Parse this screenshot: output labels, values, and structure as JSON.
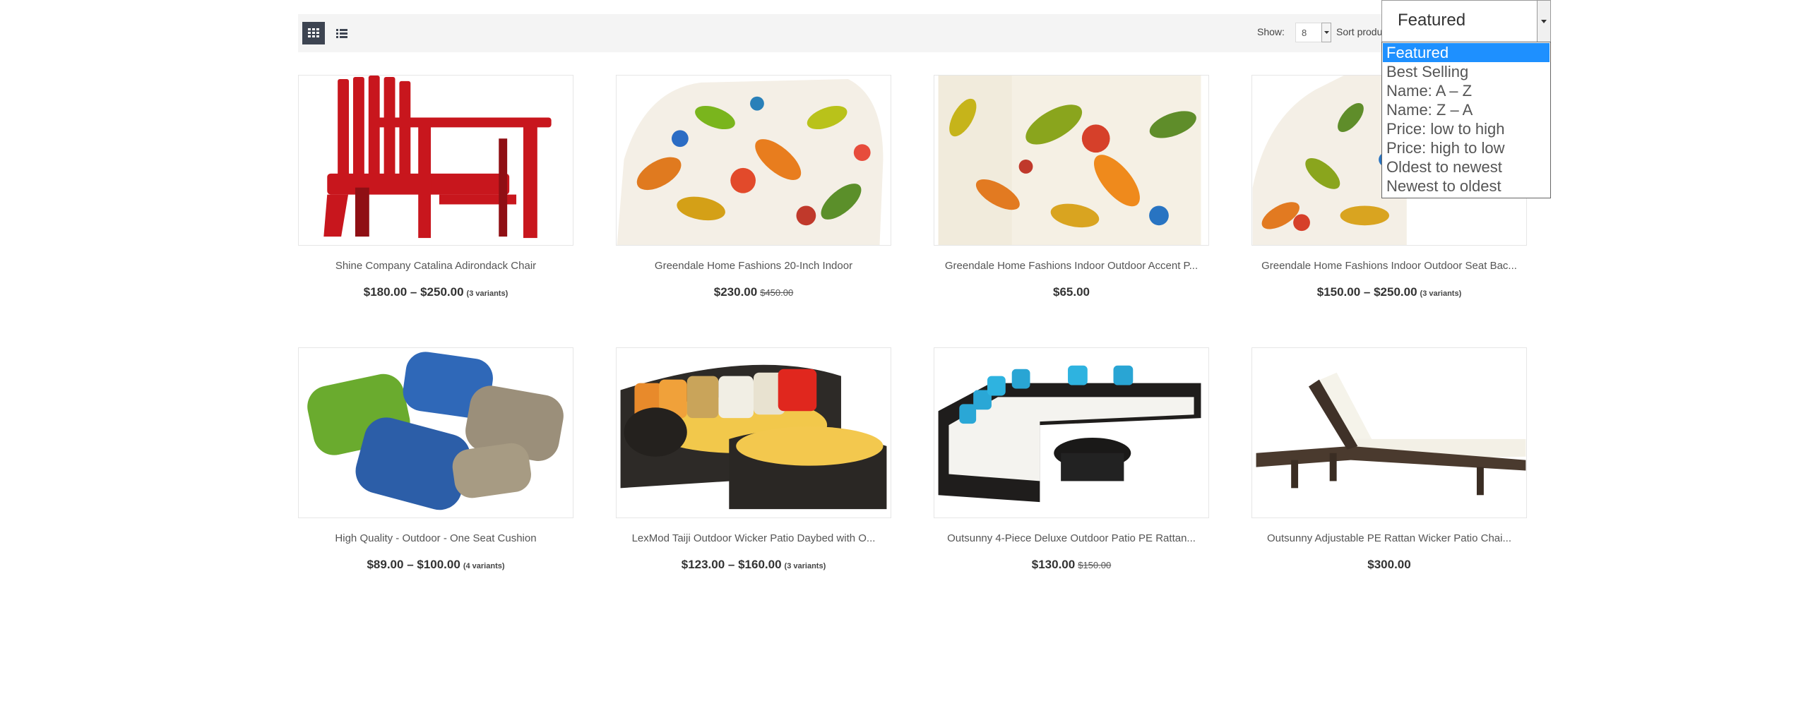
{
  "toolbar": {
    "show_label": "Show:",
    "show_value": "8",
    "sort_label": "Sort products by:",
    "sort_value": "Featured",
    "sort_options": [
      "Featured",
      "Best Selling",
      "Name: A – Z",
      "Name: Z – A",
      "Price: low to high",
      "Price: high to low",
      "Oldest to newest",
      "Newest to oldest"
    ],
    "icons": {
      "grid": "grid-view-icon",
      "list": "list-view-icon",
      "dropdown": "chevron-down-icon"
    },
    "colors": {
      "active_view_bg": "#3d4451",
      "selected_option": "#1e90ff"
    }
  },
  "products": [
    {
      "name": "Shine Company Catalina Adirondack Chair",
      "price": "$180.00 – $250.00",
      "compare": "",
      "variants": "(3 variants)"
    },
    {
      "name": "Greendale Home Fashions 20-Inch Indoor",
      "price": "$230.00",
      "compare": "$450.00",
      "variants": ""
    },
    {
      "name": "Greendale Home Fashions Indoor Outdoor Accent P...",
      "price": "$65.00",
      "compare": "",
      "variants": ""
    },
    {
      "name": "Greendale Home Fashions Indoor Outdoor Seat Bac...",
      "price": "$150.00 – $250.00",
      "compare": "",
      "variants": "(3 variants)"
    },
    {
      "name": "High Quality - Outdoor - One Seat Cushion",
      "price": "$89.00 – $100.00",
      "compare": "",
      "variants": "(4 variants)"
    },
    {
      "name": "LexMod Taiji Outdoor Wicker Patio Daybed with O...",
      "price": "$123.00 – $160.00",
      "compare": "",
      "variants": "(3 variants)"
    },
    {
      "name": "Outsunny 4-Piece Deluxe Outdoor Patio PE Rattan...",
      "price": "$130.00",
      "compare": "$150.00",
      "variants": ""
    },
    {
      "name": "Outsunny Adjustable PE Rattan Wicker Patio Chai...",
      "price": "$300.00",
      "compare": "",
      "variants": ""
    }
  ]
}
